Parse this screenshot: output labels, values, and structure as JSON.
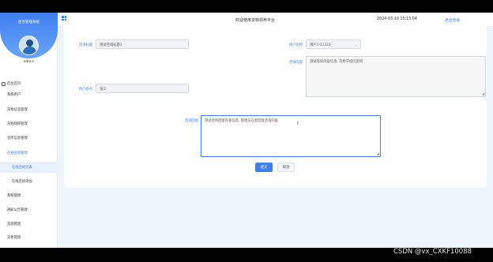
{
  "sidebar": {
    "brand_title": "后台管理系统",
    "username": "admin",
    "home_label": "后台首页",
    "items": [
      {
        "label": "系统用户"
      },
      {
        "label": "货物信息管理"
      },
      {
        "label": "货物转移管理"
      },
      {
        "label": "仓库信息管理"
      },
      {
        "label": "在线咨询管理"
      },
      {
        "label": "在线咨询列表"
      },
      {
        "label": "在线咨询添加"
      },
      {
        "label": "系统管理"
      },
      {
        "label": "通知公告管理"
      },
      {
        "label": "资源管理"
      },
      {
        "label": "交易管理"
      }
    ]
  },
  "header": {
    "title": "欢迎使用货物领养平台",
    "time": "2024-03-10 10:13:04",
    "logout": "退出登录"
  },
  "form": {
    "consult_title": {
      "label": "咨询标题",
      "value": "测试咨询标题1"
    },
    "user_account": {
      "label": "用户名称",
      "value": "用户1-11223"
    },
    "user_name": {
      "label": "用户姓名",
      "value": "张三"
    },
    "consult_content": {
      "label": "咨询内容",
      "value": "测试咨询内容信息, 可用于提问咨询"
    },
    "reply": {
      "label": "咨询回复",
      "value": "测试咨询回复内容信息, 管理员在此回复咨询内容"
    },
    "submit": "提交",
    "cancel": "取消"
  },
  "watermark": "CSDN @vx_CXKF10088"
}
